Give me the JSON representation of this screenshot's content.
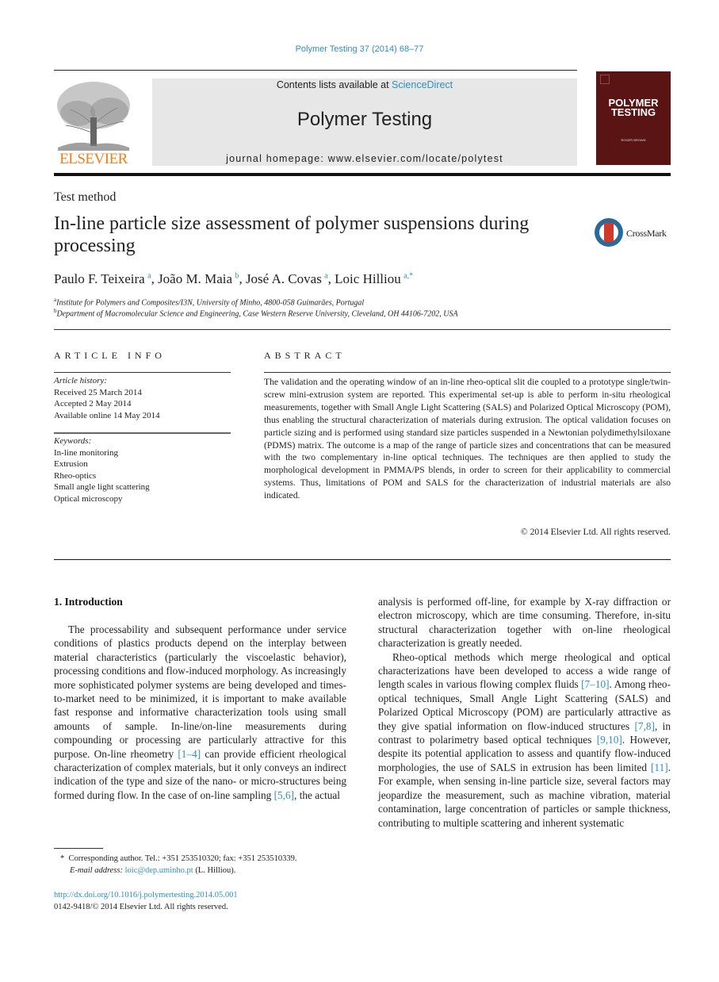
{
  "header": {
    "journal_ref": "Polymer Testing 37 (2014) 68–77",
    "contents_prefix": "Contents lists available at ",
    "contents_link": "ScienceDirect",
    "journal_name": "Polymer Testing",
    "homepage": "journal homepage: www.elsevier.com/locate/polytest",
    "publisher_logo_text": "ELSEVIER",
    "cover_title_line1": "POLYMER",
    "cover_title_line2": "TESTING",
    "cover_editor": "ROGER BROWN"
  },
  "article": {
    "section_type": "Test method",
    "title": "In-line particle size assessment of polymer suspensions during processing",
    "crossmark_label": "CrossMark",
    "authors": [
      {
        "name": "Paulo F. Teixeira",
        "sup": "a"
      },
      {
        "name": "João M. Maia",
        "sup": "b"
      },
      {
        "name": "José A. Covas",
        "sup": "a"
      },
      {
        "name": "Loic Hilliou",
        "sup": "a,*"
      }
    ],
    "affiliations": [
      {
        "sup": "a",
        "text": "Institute for Polymers and Composites/I3N, University of Minho, 4800-058 Guimarães, Portugal"
      },
      {
        "sup": "b",
        "text": "Department of Macromolecular Science and Engineering, Case Western Reserve University, Cleveland, OH 44106-7202, USA"
      }
    ]
  },
  "article_info": {
    "heading": "ARTICLE INFO",
    "history_label": "Article history:",
    "history": [
      "Received 25 March 2014",
      "Accepted 2 May 2014",
      "Available online 14 May 2014"
    ],
    "keywords_label": "Keywords:",
    "keywords": [
      "In-line monitoring",
      "Extrusion",
      "Rheo-optics",
      "Small angle light scattering",
      "Optical microscopy"
    ]
  },
  "abstract": {
    "heading": "ABSTRACT",
    "text": "The validation and the operating window of an in-line rheo-optical slit die coupled to a prototype single/twin-screw mini-extrusion system are reported. This experimental set-up is able to perform in-situ rheological measurements, together with Small Angle Light Scattering (SALS) and Polarized Optical Microscopy (POM), thus enabling the structural characterization of materials during extrusion. The optical validation focuses on particle sizing and is performed using standard size particles suspended in a Newtonian polydimethylsiloxane (PDMS) matrix. The outcome is a map of the range of particle sizes and concentrations that can be measured with the two complementary in-line optical techniques. The techniques are then applied to study the morphological development in PMMA/PS blends, in order to screen for their applicability to commercial systems. Thus, limitations of POM and SALS for the characterization of industrial materials are also indicated.",
    "copyright": "© 2014 Elsevier Ltd. All rights reserved."
  },
  "body": {
    "intro_heading": "1.  Introduction",
    "left_p1_a": "The processability and subsequent performance under service conditions of plastics products depend on the interplay between material characteristics (particularly the viscoelastic behavior), processing conditions and flow-induced morphology. As increasingly more sophisticated polymer systems are being developed and times-to-market need to be minimized, it is important to make available fast response and informative characterization tools using small amounts of sample. In-line/on-line measurements during compounding or processing are particularly attractive for this purpose. On-line rheometry ",
    "left_ref1": "[1–4]",
    "left_p1_b": " can provide efficient rheological characterization of complex materials, but it only conveys an indirect indication of the type and size of the nano- or micro-structures being formed during flow. In the case of on-line sampling ",
    "left_ref2": "[5,6]",
    "left_p1_c": ", the actual",
    "right_p1": "analysis is performed off-line, for example by X-ray diffraction or electron microscopy, which are time consuming. Therefore, in-situ structural characterization together with on-line rheological characterization is greatly needed.",
    "right_p2_a": "Rheo-optical methods which merge rheological and optical characterizations have been developed to access a wide range of length scales in various flowing complex fluids ",
    "right_ref1": "[7–10]",
    "right_p2_b": ". Among rheo-optical techniques, Small Angle Light Scattering (SALS) and Polarized Optical Microscopy (POM) are particularly attractive as they give spatial information on flow-induced structures ",
    "right_ref2": "[7,8]",
    "right_p2_c": ", in contrast to polarimetry based optical techniques ",
    "right_ref3": "[9,10]",
    "right_p2_d": ". However, despite its potential application to assess and quantify flow-induced morphologies, the use of SALS in extrusion has been limited ",
    "right_ref4": "[11]",
    "right_p2_e": ". For example, when sensing in-line particle size, several factors may jeopardize the measurement, such as machine vibration, material contamination, large concentration of particles or sample thickness, contributing to multiple scattering and inherent systematic"
  },
  "footnote": {
    "star": "*",
    "corresponding": "Corresponding author. Tel.: +351 253510320; fax: +351 253510339.",
    "email_label": "E-mail address: ",
    "email": "loic@dep.uminho.pt",
    "email_suffix": " (L. Hilliou).",
    "doi": "http://dx.doi.org/10.1016/j.polymertesting.2014.05.001",
    "issn_copyright": "0142-9418/© 2014 Elsevier Ltd. All rights reserved."
  },
  "colors": {
    "link": "#2e8fc0",
    "elsevier_orange": "#f07f1a",
    "cover_bg": "#5a1414",
    "masthead_bg": "#e7e7e7"
  }
}
